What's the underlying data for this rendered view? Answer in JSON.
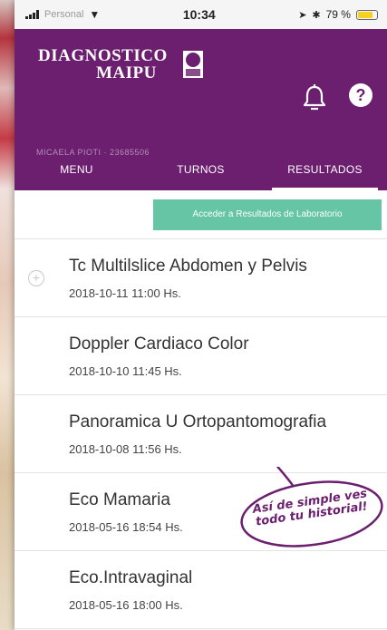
{
  "status_bar": {
    "carrier": "Personal",
    "time": "10:34",
    "battery": "79 %",
    "battery_level": 0.79
  },
  "header": {
    "logo_line1": "DIAGNOSTICO",
    "logo_line2": "MAIPU",
    "user_info": "MICAELA PIOTI · 23685506",
    "bell_icon": "bell-icon",
    "help_icon": "help-icon",
    "help_glyph": "?",
    "brand_color": "#6b1f6e"
  },
  "tabs": [
    {
      "label": "MENU"
    },
    {
      "label": "TURNOS"
    },
    {
      "label": "RESULTADOS",
      "active": true
    }
  ],
  "lab_button": {
    "label": "Acceder a Resultados de Laboratorio",
    "color": "#66c5a5"
  },
  "results": [
    {
      "title": "Tc Multilslice Abdomen y Pelvis",
      "date": "2018-10-11 11:00 Hs."
    },
    {
      "title": "Doppler Cardiaco Color",
      "date": "2018-10-10 11:45 Hs."
    },
    {
      "title": "Panoramica U Ortopantomografia",
      "date": "2018-10-08 11:56 Hs."
    },
    {
      "title": "Eco Mamaria",
      "date": "2018-05-16 18:54 Hs."
    },
    {
      "title": "Eco.Intravaginal",
      "date": "2018-05-16 18:00 Hs."
    }
  ],
  "annotation": {
    "line1": "Así de simple ves",
    "line2": "todo tu historial!"
  }
}
